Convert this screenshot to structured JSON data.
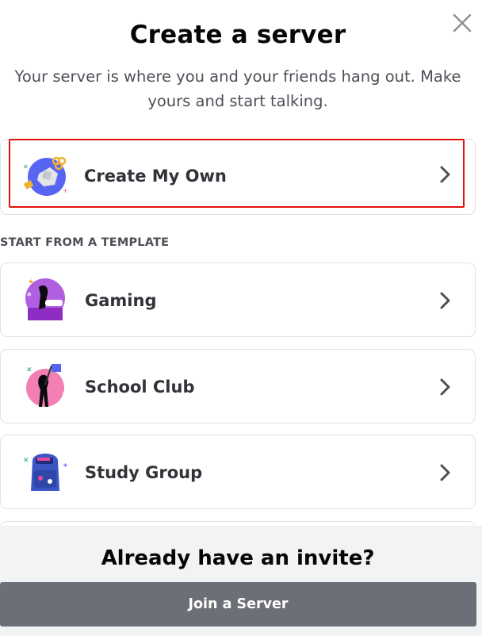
{
  "modal": {
    "title": "Create a server",
    "subtitle": "Your server is where you and your friends hang out. Make yours and start talking.",
    "close_icon": "close-icon"
  },
  "create_own": {
    "label": "Create My Own",
    "icon": "create-own-icon",
    "chevron": "chevron-right-icon"
  },
  "templates": {
    "header": "START FROM A TEMPLATE",
    "items": [
      {
        "label": "Gaming",
        "icon": "gaming-icon"
      },
      {
        "label": "School Club",
        "icon": "school-club-icon"
      },
      {
        "label": "Study Group",
        "icon": "study-group-icon"
      }
    ]
  },
  "footer": {
    "title": "Already have an invite?",
    "join_label": "Join a Server"
  },
  "colors": {
    "highlight": "#e0130f",
    "join_button": "#6d6f78",
    "footer_bg": "#f2f3f5"
  }
}
